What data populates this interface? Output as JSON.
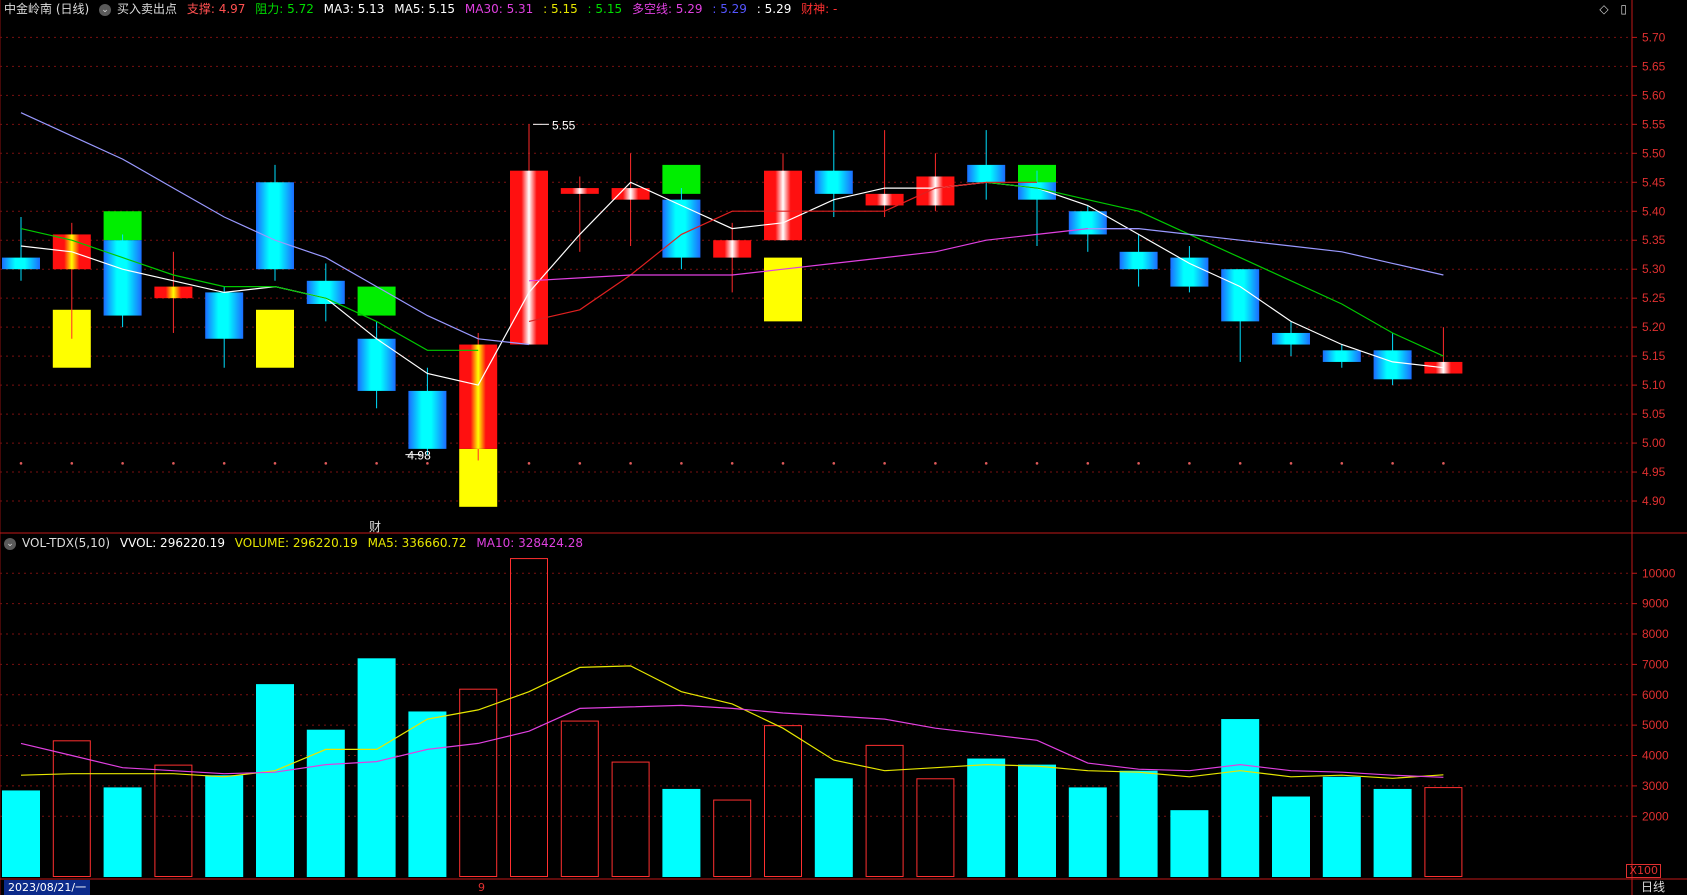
{
  "header": {
    "stock_name": "中金岭南 (日线)",
    "indicator_name": "买入卖出点",
    "support_label": "支撑: 4.97",
    "resistance_label": "阻力: 5.72",
    "ma3_label": "MA3: 5.13",
    "ma5_label": "MA5: 5.15",
    "ma30_label": "MA30: 5.31",
    "val_a": ": 5.15",
    "val_b": ": 5.15",
    "duokong_label": "多空线: 5.29",
    "val_c": ": 5.29",
    "val_d": ": 5.29",
    "caishen_label": "财神: -"
  },
  "volume_header": {
    "name": "VOL-TDX(5,10)",
    "vvol": "VVOL: 296220.19",
    "volume": "VOLUME: 296220.19",
    "ma5": "MA5: 336660.72",
    "ma10": "MA10: 328424.28"
  },
  "window_controls": {
    "diamond": "◇",
    "restore": "▯"
  },
  "footer": {
    "date": "2023/08/21/一",
    "period": "日线",
    "scale": "X100"
  },
  "markers": {
    "cai": "财",
    "nine": "9",
    "high_label": "5.55",
    "low_label": "4.98"
  },
  "colors": {
    "up": "#ff2a2a",
    "down_cyan": "#00ffff",
    "down_blue": "#1b6bff",
    "yellow": "#ffff00",
    "green": "#00ee00",
    "ma_white": "#ffffff",
    "ma_green": "#00c800",
    "ma_red": "#e02020",
    "ma_magenta": "#e040e0",
    "ma_lavender": "#9999ff",
    "grid_red": "#7a1010"
  },
  "chart_data": [
    {
      "type": "candlestick",
      "ylim": [
        4.85,
        5.73
      ],
      "y_ticks": [
        5.7,
        5.65,
        5.6,
        5.55,
        5.5,
        5.45,
        5.4,
        5.35,
        5.3,
        5.25,
        5.2,
        5.15,
        5.1,
        5.05,
        5.0,
        4.95,
        4.9
      ],
      "candles": [
        {
          "open": 5.32,
          "high": 5.39,
          "low": 5.28,
          "close": 5.3
        },
        {
          "open": 5.3,
          "high": 5.38,
          "low": 5.18,
          "close": 5.36
        },
        {
          "open": 5.35,
          "high": 5.36,
          "low": 5.2,
          "close": 5.22
        },
        {
          "open": 5.25,
          "high": 5.33,
          "low": 5.19,
          "close": 5.27
        },
        {
          "open": 5.26,
          "high": 5.27,
          "low": 5.13,
          "close": 5.18
        },
        {
          "open": 5.45,
          "high": 5.48,
          "low": 5.28,
          "close": 5.3
        },
        {
          "open": 5.28,
          "high": 5.31,
          "low": 5.21,
          "close": 5.24
        },
        {
          "open": 5.18,
          "high": 5.21,
          "low": 5.06,
          "close": 5.09
        },
        {
          "open": 5.09,
          "high": 5.13,
          "low": 4.98,
          "close": 4.99
        },
        {
          "open": 4.99,
          "high": 5.19,
          "low": 4.97,
          "close": 5.17
        },
        {
          "open": 5.17,
          "high": 5.55,
          "low": 5.17,
          "close": 5.47
        },
        {
          "open": 5.43,
          "high": 5.46,
          "low": 5.33,
          "close": 5.44
        },
        {
          "open": 5.42,
          "high": 5.5,
          "low": 5.34,
          "close": 5.44
        },
        {
          "open": 5.42,
          "high": 5.44,
          "low": 5.3,
          "close": 5.32
        },
        {
          "open": 5.32,
          "high": 5.38,
          "low": 5.26,
          "close": 5.35
        },
        {
          "open": 5.35,
          "high": 5.5,
          "low": 5.35,
          "close": 5.47
        },
        {
          "open": 5.47,
          "high": 5.54,
          "low": 5.39,
          "close": 5.43
        },
        {
          "open": 5.41,
          "high": 5.54,
          "low": 5.39,
          "close": 5.43
        },
        {
          "open": 5.41,
          "high": 5.5,
          "low": 5.4,
          "close": 5.46
        },
        {
          "open": 5.48,
          "high": 5.54,
          "low": 5.42,
          "close": 5.45
        },
        {
          "open": 5.45,
          "high": 5.47,
          "low": 5.34,
          "close": 5.42
        },
        {
          "open": 5.4,
          "high": 5.41,
          "low": 5.33,
          "close": 5.36
        },
        {
          "open": 5.33,
          "high": 5.36,
          "low": 5.27,
          "close": 5.3
        },
        {
          "open": 5.32,
          "high": 5.34,
          "low": 5.26,
          "close": 5.27
        },
        {
          "open": 5.3,
          "high": 5.3,
          "low": 5.14,
          "close": 5.21
        },
        {
          "open": 5.19,
          "high": 5.21,
          "low": 5.15,
          "close": 5.17
        },
        {
          "open": 5.16,
          "high": 5.17,
          "low": 5.13,
          "close": 5.14
        },
        {
          "open": 5.16,
          "high": 5.19,
          "low": 5.1,
          "close": 5.11
        },
        {
          "open": 5.12,
          "high": 5.2,
          "low": 5.12,
          "close": 5.14
        }
      ],
      "sell_markers": [
        {
          "index": 2,
          "top": 5.4,
          "bottom": 5.35
        },
        {
          "index": 7,
          "top": 5.27,
          "bottom": 5.22
        },
        {
          "index": 13,
          "top": 5.48,
          "bottom": 5.43
        },
        {
          "index": 20,
          "top": 5.48,
          "bottom": 5.43
        }
      ],
      "buy_markers": [
        {
          "index": 1,
          "top": 5.23,
          "bottom": 5.13
        },
        {
          "index": 5,
          "top": 5.23,
          "bottom": 5.13
        },
        {
          "index": 9,
          "top": 4.99,
          "bottom": 4.89
        },
        {
          "index": 15,
          "top": 5.32,
          "bottom": 5.21
        }
      ],
      "series": [
        {
          "key": "ma3",
          "color": "#ffffff",
          "values": [
            5.34,
            5.33,
            5.3,
            5.28,
            5.26,
            5.27,
            5.25,
            5.18,
            5.12,
            5.1,
            5.26,
            5.36,
            5.45,
            5.41,
            5.37,
            5.38,
            5.42,
            5.44,
            5.44,
            5.45,
            5.44,
            5.41,
            5.36,
            5.31,
            5.27,
            5.21,
            5.17,
            5.14,
            5.13
          ]
        },
        {
          "key": "ma5",
          "color": "#00c800",
          "values": [
            5.37,
            5.35,
            5.32,
            5.29,
            5.27,
            5.27,
            5.25,
            5.21,
            5.16,
            5.16,
            null,
            null,
            null,
            null,
            null,
            null,
            null,
            null,
            null,
            5.45,
            5.44,
            5.42,
            5.4,
            5.36,
            5.32,
            5.28,
            5.24,
            5.19,
            5.15
          ]
        },
        {
          "key": "ma_red",
          "color": "#e02020",
          "values": [
            null,
            null,
            null,
            null,
            null,
            null,
            null,
            null,
            null,
            null,
            5.21,
            5.23,
            5.29,
            5.36,
            5.4,
            5.4,
            5.4,
            5.4,
            5.44,
            5.45,
            5.45
          ]
        },
        {
          "key": "ma30",
          "color": "#e040e0",
          "values": [
            null,
            null,
            null,
            null,
            null,
            null,
            null,
            null,
            null,
            null,
            5.28,
            5.285,
            5.29,
            5.29,
            5.29,
            5.3,
            5.31,
            5.32,
            5.33,
            5.35,
            5.36,
            5.37,
            5.37
          ]
        },
        {
          "key": "duokong",
          "color": "#9999ff",
          "values": [
            5.57,
            5.53,
            5.49,
            5.44,
            5.39,
            5.35,
            5.32,
            5.27,
            5.22,
            5.18,
            5.17,
            null,
            null,
            null,
            null,
            null,
            null,
            null,
            null,
            null,
            null,
            5.37,
            5.37,
            5.36,
            5.35,
            5.34,
            5.33,
            5.31,
            5.29
          ]
        }
      ]
    },
    {
      "type": "bar",
      "ylim": [
        0,
        10700
      ],
      "y_ticks": [
        10000,
        9000,
        8000,
        7000,
        6000,
        5000,
        4000,
        3000,
        2000
      ],
      "volumes": [
        2850,
        4500,
        2950,
        3700,
        3350,
        6350,
        4850,
        7200,
        5450,
        6200,
        10500,
        5150,
        3800,
        2900,
        2550,
        5000,
        3250,
        4350,
        3250,
        3900,
        3700,
        2950,
        3500,
        2200,
        5200,
        2650,
        3300,
        2900,
        2960
      ],
      "up_flags": [
        false,
        true,
        false,
        true,
        false,
        false,
        false,
        false,
        false,
        true,
        true,
        true,
        true,
        false,
        true,
        true,
        false,
        true,
        true,
        false,
        false,
        false,
        false,
        false,
        false,
        false,
        false,
        false,
        true
      ],
      "series": [
        {
          "key": "vol_ma5",
          "color": "#e6e600",
          "values": [
            3350,
            3400,
            3400,
            3400,
            3300,
            3500,
            4200,
            4200,
            5200,
            5500,
            6100,
            6900,
            6950,
            6100,
            5700,
            4900,
            3850,
            3500,
            3600,
            3700,
            3650,
            3500,
            3450,
            3300,
            3500,
            3300,
            3350,
            3250,
            3366
          ]
        },
        {
          "key": "vol_ma10",
          "color": "#e040e0",
          "values": [
            4400,
            4000,
            3600,
            3500,
            3400,
            3450,
            3700,
            3800,
            4200,
            4400,
            4800,
            5550,
            5600,
            5650,
            5550,
            5400,
            5300,
            5200,
            4900,
            4700,
            4500,
            3750,
            3550,
            3500,
            3700,
            3500,
            3450,
            3350,
            3284
          ]
        }
      ]
    }
  ]
}
